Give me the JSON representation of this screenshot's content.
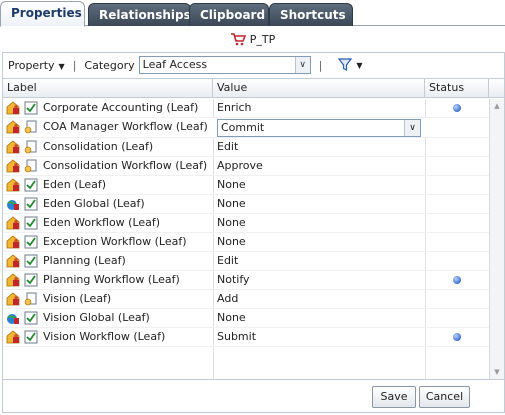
{
  "tabs": [
    {
      "label": "Properties",
      "active": true
    },
    {
      "label": "Relationships"
    },
    {
      "label": "Clipboard"
    },
    {
      "label": "Shortcuts"
    }
  ],
  "node_title": "P_TP",
  "toolbar": {
    "property_label": "Property",
    "category_label": "Category",
    "category_value": "Leaf Access",
    "filter_icon": "filter-icon"
  },
  "table": {
    "columns": [
      "Label",
      "Value",
      "Status"
    ],
    "rows": [
      {
        "label": "Corporate Accounting (Leaf)",
        "value": "Enrich",
        "status": true,
        "icon": "check"
      },
      {
        "label": "COA Manager Workflow (Leaf)",
        "value": "Commit",
        "status": false,
        "icon": "doc",
        "editing": true
      },
      {
        "label": "Consolidation (Leaf)",
        "value": "Edit",
        "status": false,
        "icon": "doc"
      },
      {
        "label": "Consolidation Workflow (Leaf)",
        "value": "Approve",
        "status": false,
        "icon": "doc"
      },
      {
        "label": "Eden (Leaf)",
        "value": "None",
        "status": false,
        "icon": "check"
      },
      {
        "label": "Eden Global (Leaf)",
        "value": "None",
        "status": false,
        "icon": "check",
        "globe": true
      },
      {
        "label": "Eden Workflow (Leaf)",
        "value": "None",
        "status": false,
        "icon": "check"
      },
      {
        "label": "Exception Workflow (Leaf)",
        "value": "None",
        "status": false,
        "icon": "check"
      },
      {
        "label": "Planning (Leaf)",
        "value": "Edit",
        "status": false,
        "icon": "check"
      },
      {
        "label": "Planning Workflow (Leaf)",
        "value": "Notify",
        "status": true,
        "icon": "check"
      },
      {
        "label": "Vision (Leaf)",
        "value": "Add",
        "status": false,
        "icon": "doc"
      },
      {
        "label": "Vision Global (Leaf)",
        "value": "None",
        "status": false,
        "icon": "check",
        "globe": true
      },
      {
        "label": "Vision Workflow (Leaf)",
        "value": "Submit",
        "status": true,
        "icon": "check"
      }
    ]
  },
  "buttons": {
    "save": "Save",
    "cancel": "Cancel"
  },
  "colors": {
    "tab_dark": "#3b4756",
    "active_tab_text": "#1d3b6a",
    "status_dot": "#3d6fd0"
  }
}
